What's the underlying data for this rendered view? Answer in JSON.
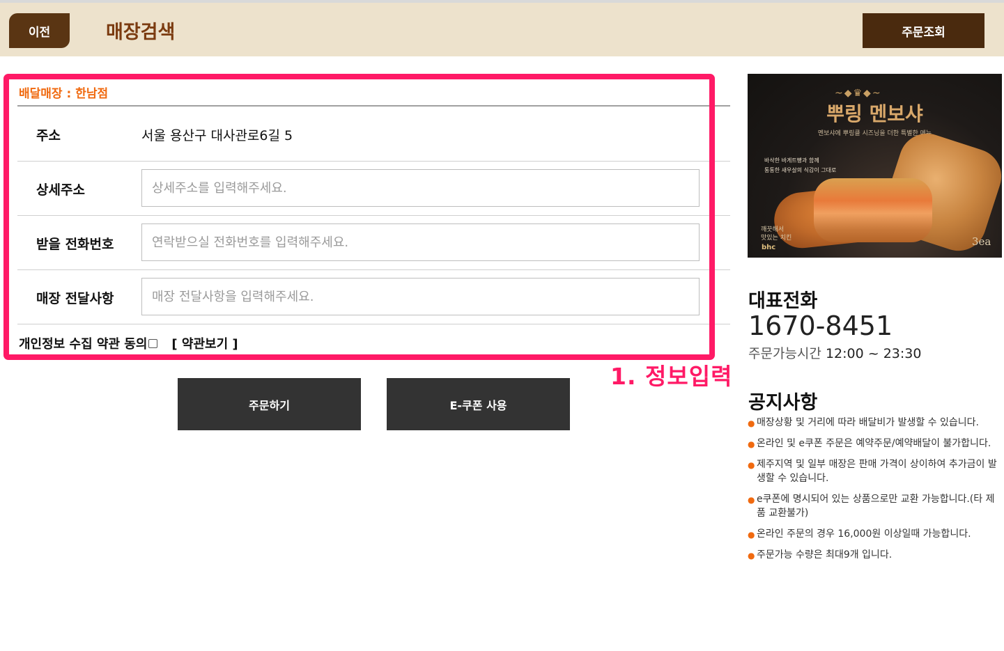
{
  "header": {
    "back_label": "이전",
    "title": "매장검색",
    "order_check_label": "주문조회"
  },
  "form": {
    "store_label": "배달매장 : 한남점",
    "address_label": "주소",
    "address_value": "서울 용산구 대사관로6길 5",
    "detail_label": "상세주소",
    "detail_placeholder": "상세주소를 입력해주세요.",
    "phone_label": "받을 전화번호",
    "phone_placeholder": "연락받으실 전화번호를 입력해주세요.",
    "message_label": "매장 전달사항",
    "message_placeholder": "매장 전달사항을 입력해주세요.",
    "agree_label": "개인정보 수집 약관 동의",
    "terms_link": "[ 약관보기 ]"
  },
  "annotation": {
    "step_label": "1. 정보입력",
    "highlight_color": "#ff1a66"
  },
  "actions": {
    "order_label": "주문하기",
    "ecoupon_label": "E-쿠폰 사용"
  },
  "promo": {
    "title": "뿌링 멘보샤",
    "subtitle": "멘보샤에 뿌링클 시즈닝을 더한 특별한 메뉴",
    "feature_1": "바삭한 바게트빵과 함께",
    "feature_2": "통통한 새우살의 식감이 그대로",
    "slogan_1": "깨끗해서",
    "slogan_2": "맛있는 치킨",
    "brand": "bhc",
    "quantity": "3ea"
  },
  "contact": {
    "title": "대표전화",
    "phone": "1670-8451",
    "hours_label": "주문가능시간",
    "hours_value": "12:00 ~ 23:30"
  },
  "notices": {
    "title": "공지사항",
    "items": [
      "매장상황 및 거리에 따라 배달비가 발생할 수 있습니다.",
      "온라인 및 e쿠폰 주문은 예약주문/예약배달이 불가합니다.",
      "제주지역 및 일부 매장은 판매 가격이 상이하여 추가금이 발생할 수 있습니다.",
      "e쿠폰에 명시되어 있는 상품으로만 교환 가능합니다.(타 제품 교환불가)",
      "온라인 주문의 경우 16,000원 이상일때 가능합니다.",
      "주문가능 수량은 최대9개 입니다."
    ]
  },
  "colors": {
    "header_bg": "#ede2cc",
    "brand_brown": "#5a3513",
    "accent_orange": "#f06a10",
    "button_dark": "#333333"
  }
}
